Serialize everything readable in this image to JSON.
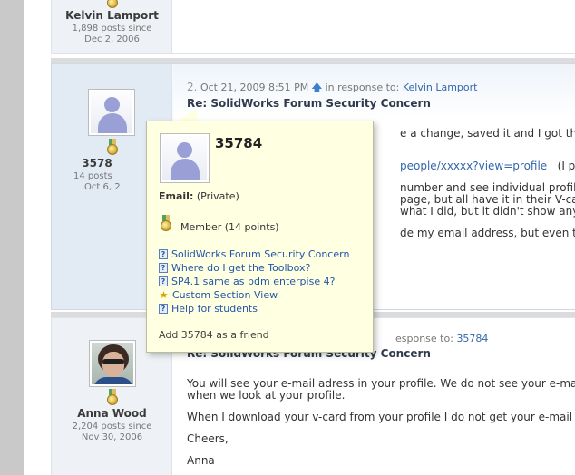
{
  "posts": [
    {
      "author": "Kelvin Lamport",
      "posts_line": "1,898 posts since",
      "since": "Dec 2, 2006"
    },
    {
      "author_partial": "3578",
      "posts_line_partial": "14 posts",
      "since_partial": "Oct 6, 2",
      "number": "2.",
      "date": "Oct 21, 2009 8:51 PM",
      "in_response_label": "in response to:",
      "in_response_to": "Kelvin Lamport",
      "title": "Re: SolidWorks Forum Security Concern",
      "body_lines": [
        "e a change, saved it and I got the following",
        "people/xxxxx?view=profile",
        "(I put the x's i",
        "number and see individual profiles. Some h",
        "page, but all have it in their V-card, which c",
        "what I did, but it didn't show any emails. Ve",
        "de my email address, but even though the \""
      ]
    },
    {
      "author": "Anna Wood",
      "posts_line": "2,204 posts since",
      "since": "Nov 30, 2006",
      "in_response_label_partial": "esponse to:",
      "in_response_to": "35784",
      "title_partial": "Re: SolidWorks Forum Security Concern",
      "body_lines": [
        "You will see your e-mail adress in your profile. We do not see your e-mail",
        "when we look at your profile.",
        "When I download your v-card from your profile I do not get your e-mail a",
        "Cheers,",
        "Anna"
      ]
    }
  ],
  "popup": {
    "name": "35784",
    "email_label": "Email:",
    "email_value": "(Private)",
    "member_text": "Member (14 points)",
    "links": [
      {
        "label": "SolidWorks Forum Security Concern",
        "icon": "question-icon"
      },
      {
        "label": "Where do I get the Toolbox?",
        "icon": "question-icon"
      },
      {
        "label": "SP4.1 same as pdm enterpise 4?",
        "icon": "question-icon"
      },
      {
        "label": "Custom Section View",
        "icon": "star-icon"
      },
      {
        "label": "Help for students",
        "icon": "question-icon"
      }
    ],
    "add_friend": "Add 35784 as a friend"
  },
  "icons": {
    "medal": "medal-icon",
    "up_arrow": "up-arrow-icon"
  },
  "colors": {
    "link": "#3366aa",
    "popup_bg": "#ffffe1",
    "gutter": "#c9c9c9"
  }
}
